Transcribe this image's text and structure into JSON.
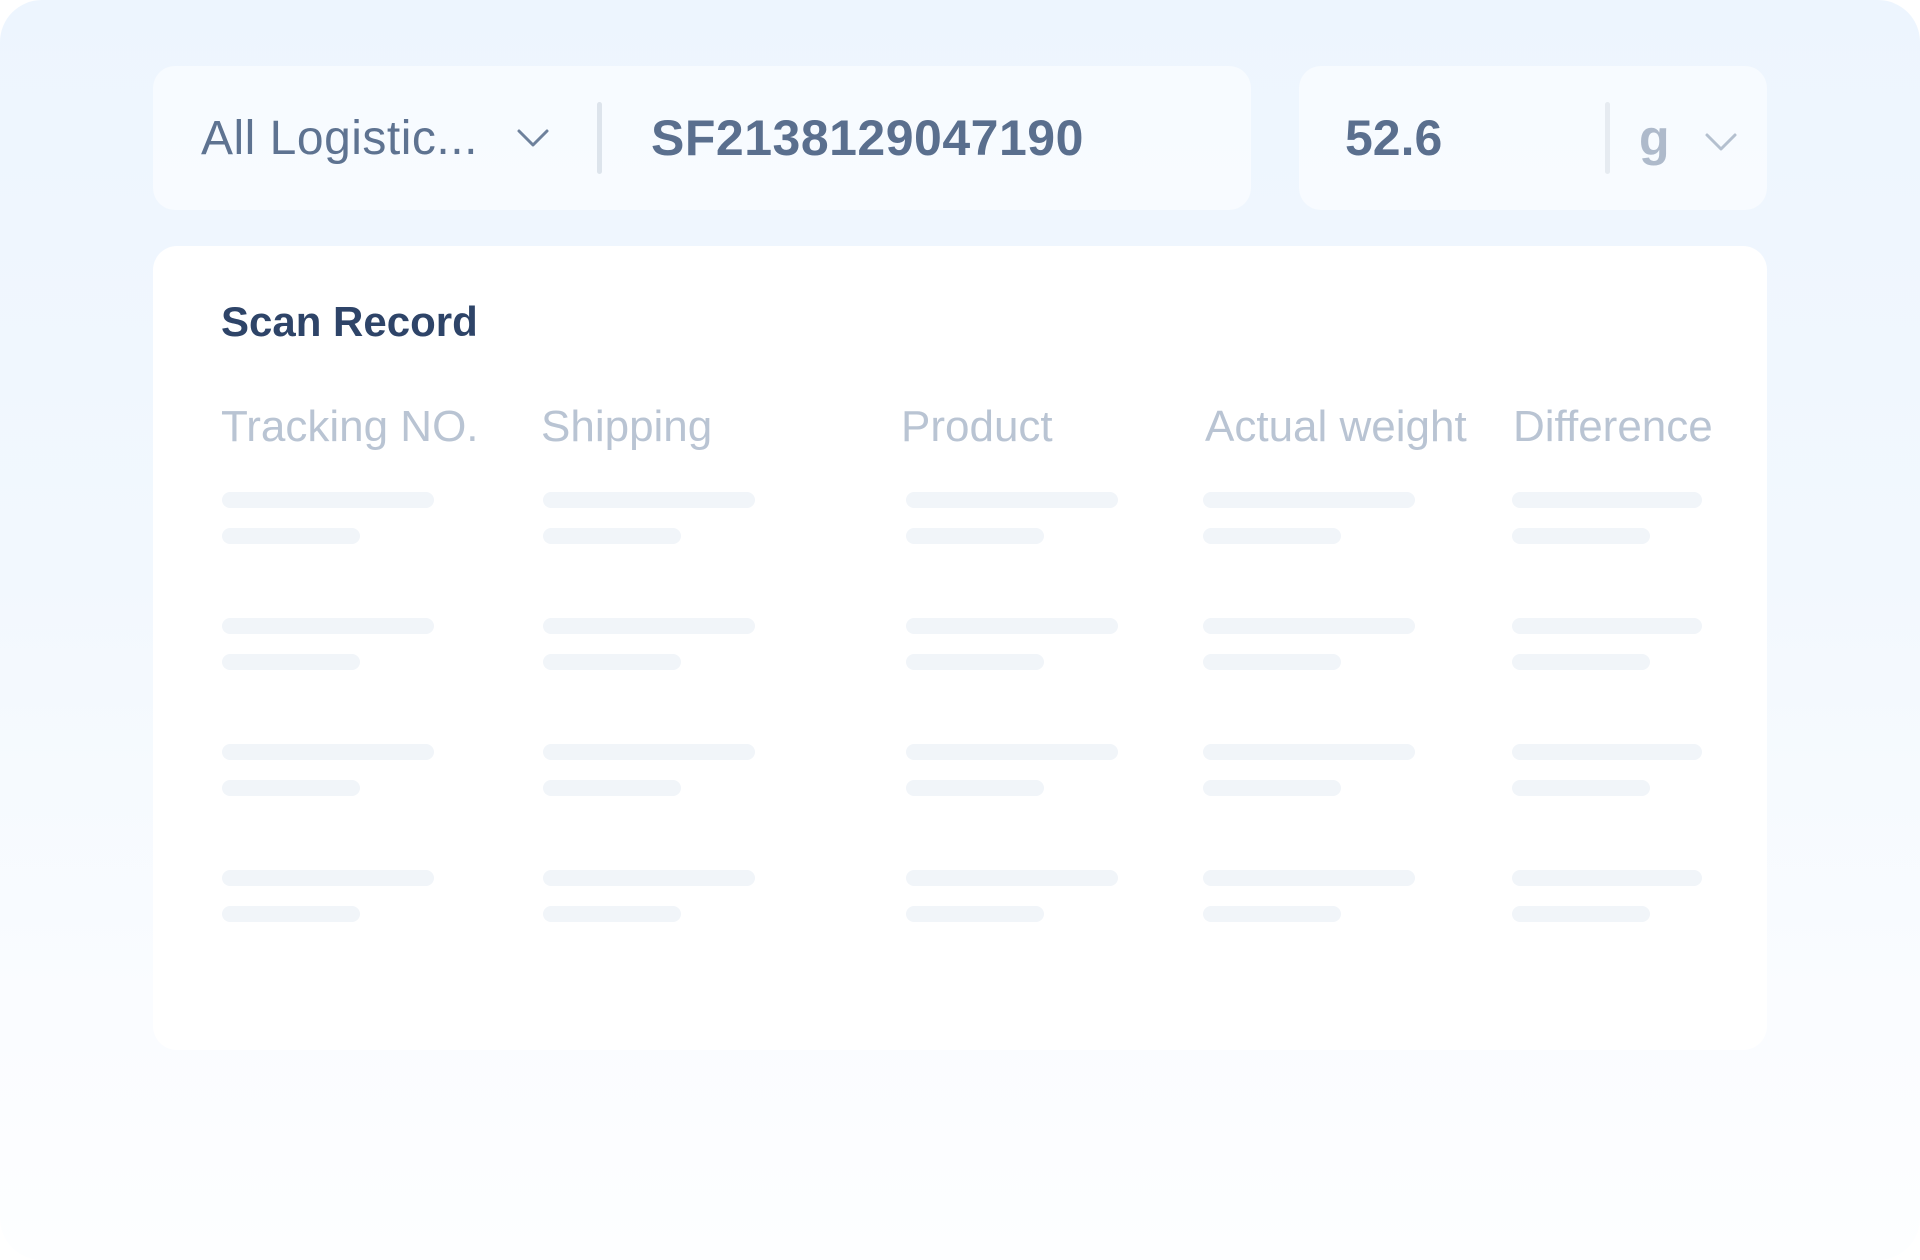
{
  "toolbar": {
    "carrier_select": {
      "label": "All Logistic..."
    },
    "tracking_input": {
      "value": "SF2138129047190"
    },
    "weight_input": {
      "value": "52.6"
    },
    "unit_select": {
      "label": "g"
    }
  },
  "scan_record": {
    "title": "Scan Record",
    "columns": [
      "Tracking NO.",
      "Shipping",
      "Product",
      "Actual weight",
      "Difference"
    ],
    "loading_rows": 4
  },
  "colors": {
    "text_primary": "#5a6f8e",
    "title": "#2e4468",
    "header_muted": "#b9c4d3",
    "skeleton": "#f1f5f9"
  },
  "icons": {
    "dropdown": "chevron-down-icon"
  }
}
